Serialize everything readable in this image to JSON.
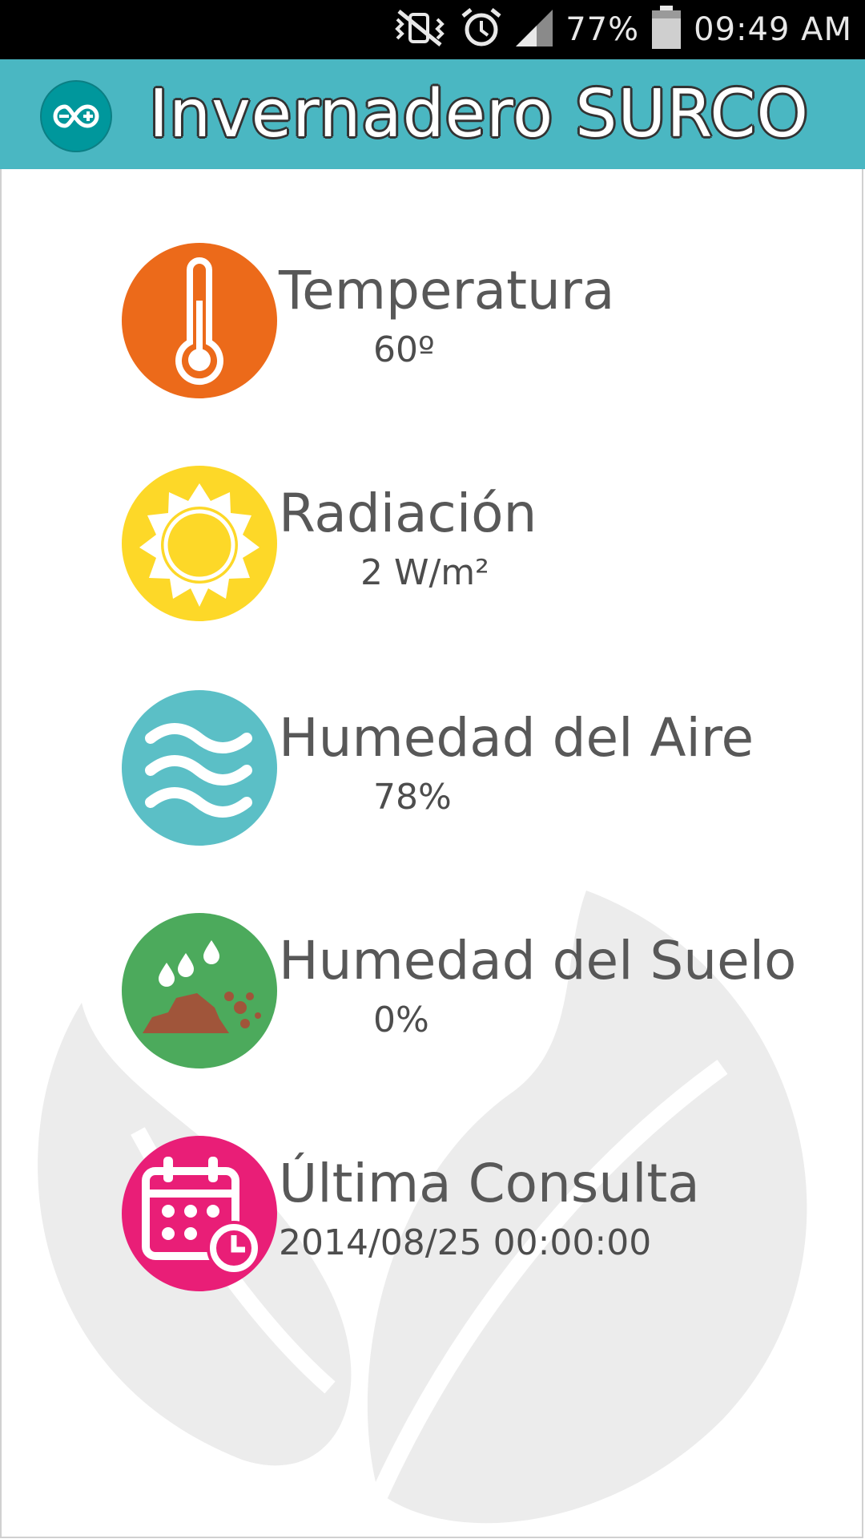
{
  "status_bar": {
    "battery_percent": "77%",
    "time": "09:49 AM",
    "icons": [
      "mute-vibrate-icon",
      "alarm-icon",
      "signal-icon",
      "battery-icon"
    ]
  },
  "app_bar": {
    "title": "Invernadero SURCO",
    "logo_icon": "arduino-logo-icon",
    "color": "#4ab7c2"
  },
  "sensors": [
    {
      "label": "Temperatura",
      "value": "60º",
      "icon": "thermometer-icon",
      "color": "#ec6a1a"
    },
    {
      "label": "Radiación",
      "value": "2 W/m²",
      "icon": "sun-icon",
      "color": "#fdd828"
    },
    {
      "label": "Humedad del Aire",
      "value": "78%",
      "icon": "air-waves-icon",
      "color": "#5bbfc6"
    },
    {
      "label": "Humedad del Suelo",
      "value": "0%",
      "icon": "soil-drops-icon",
      "color": "#4caa5c"
    },
    {
      "label": "Última Consulta",
      "value": "2014/08/25 00:00:00",
      "icon": "calendar-clock-icon",
      "color": "#e91e77"
    }
  ]
}
